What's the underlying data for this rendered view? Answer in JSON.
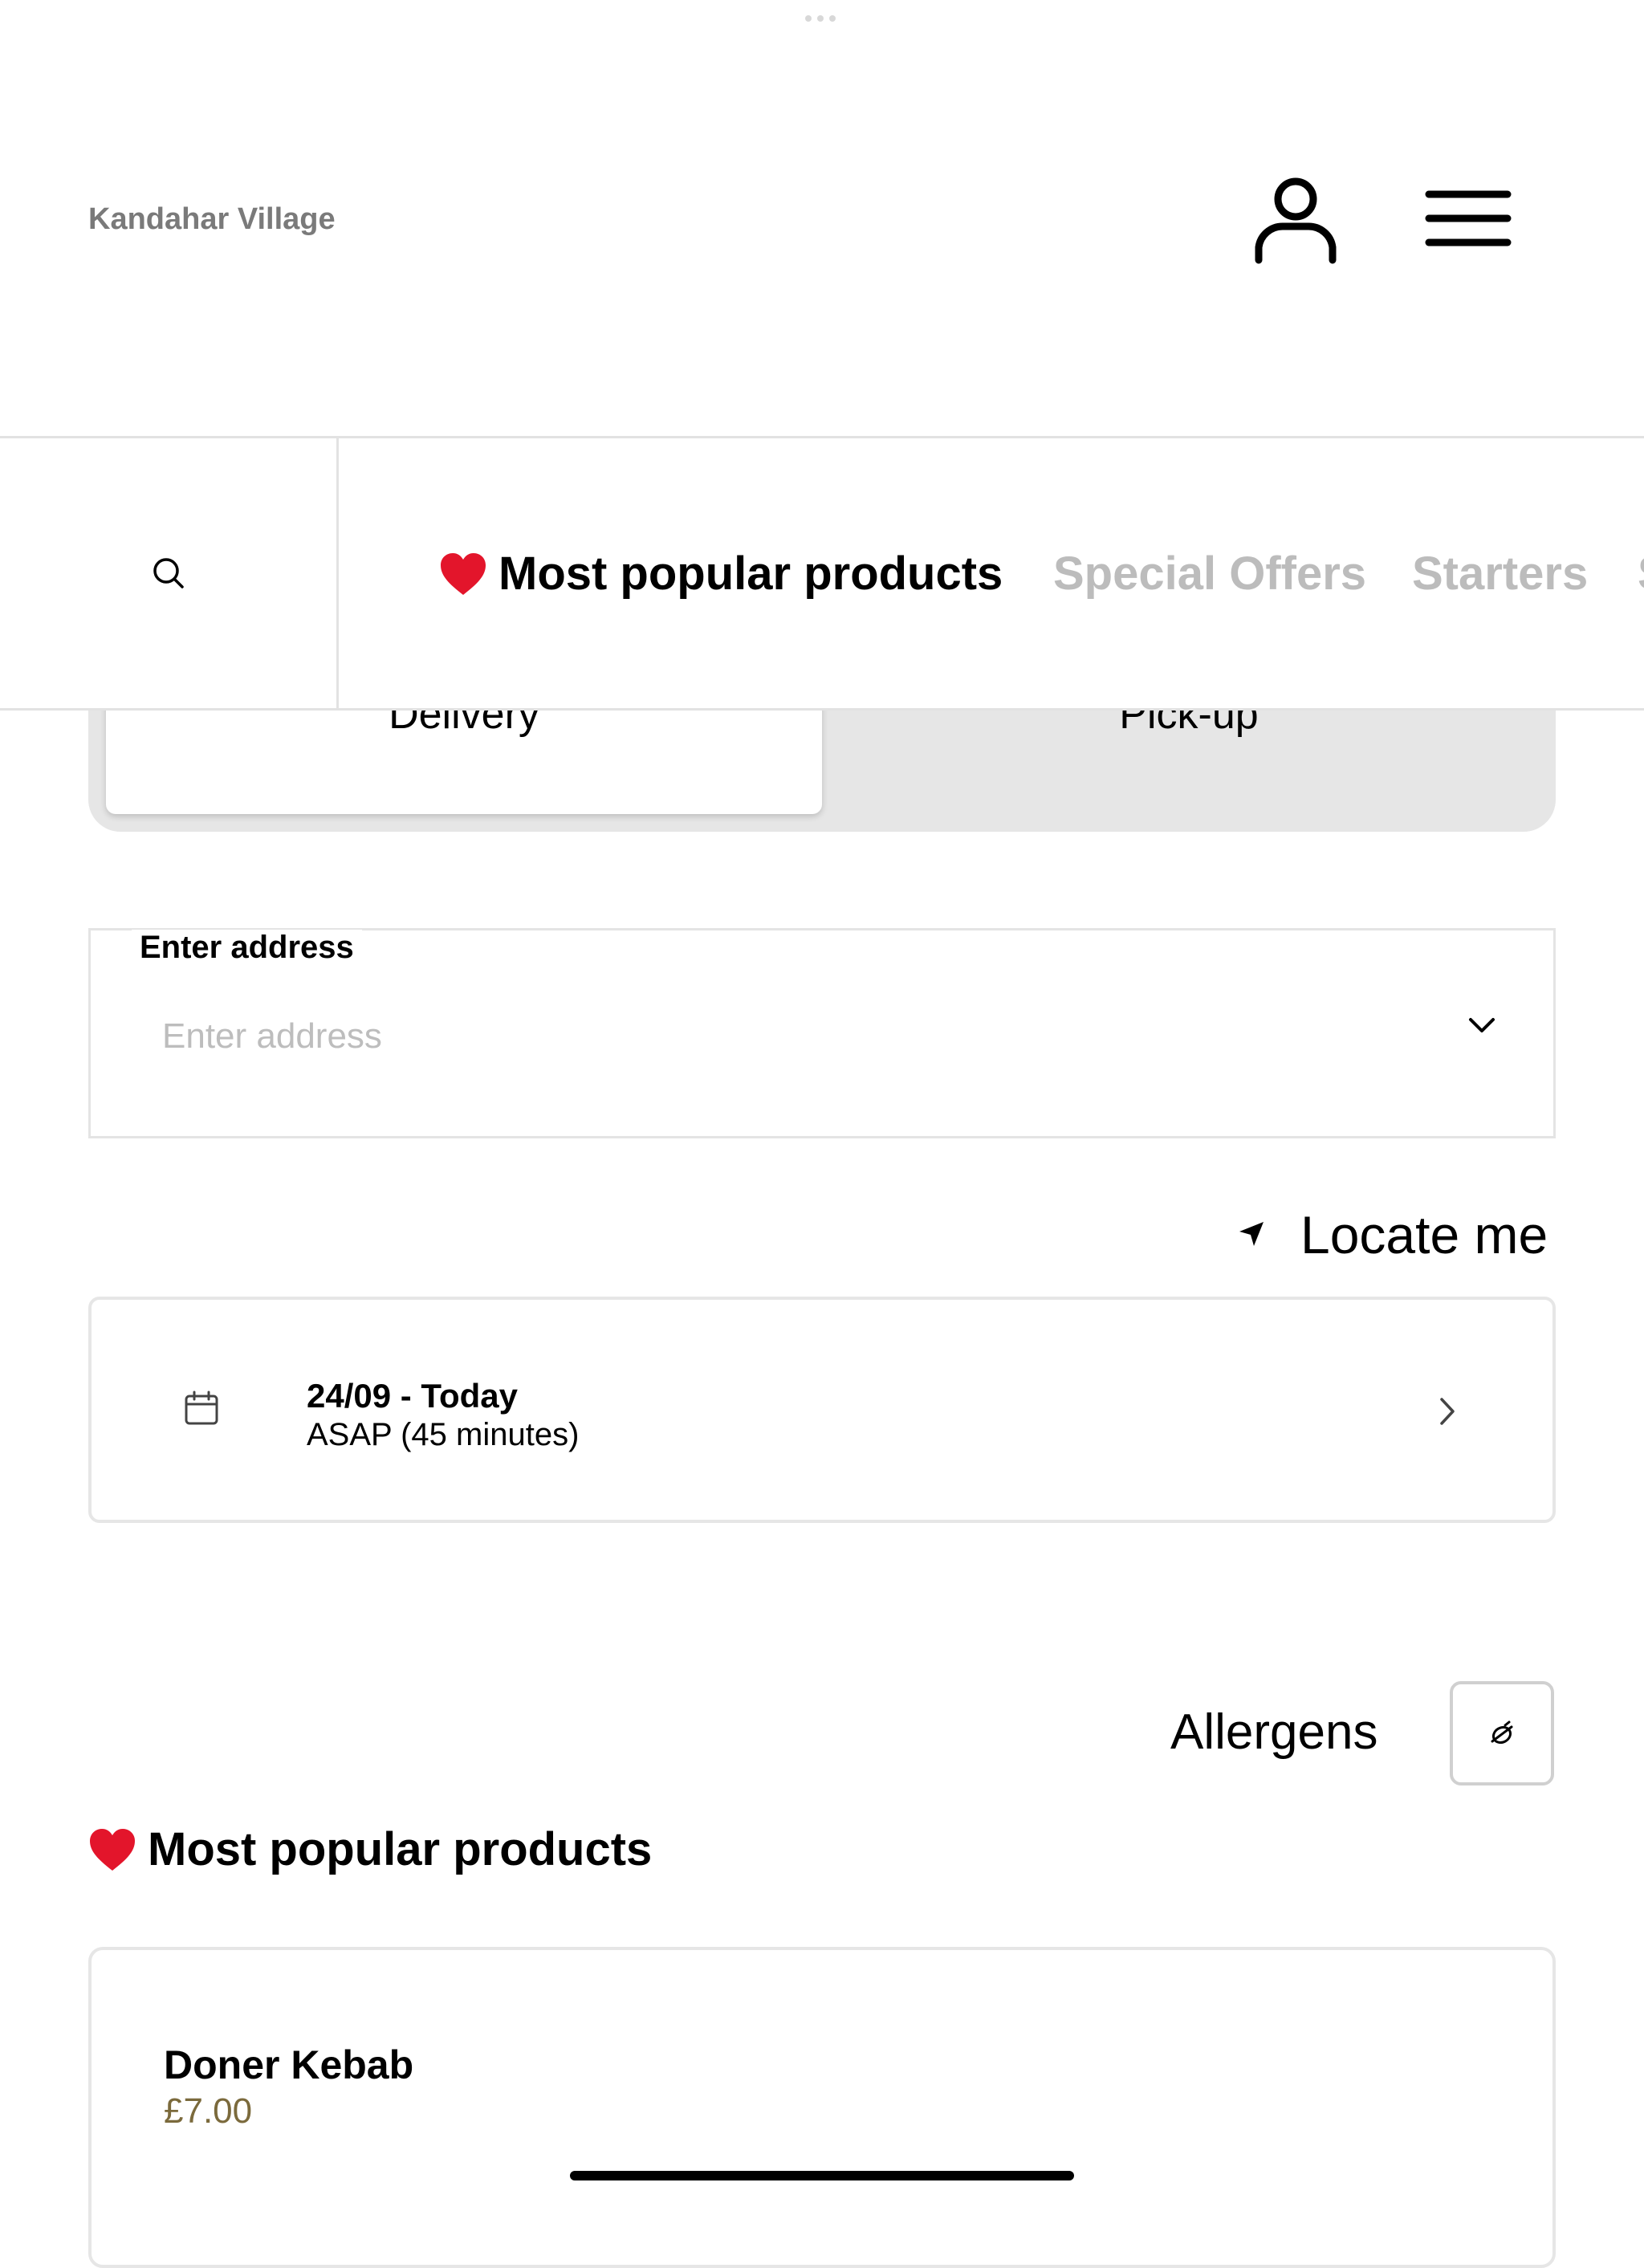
{
  "header": {
    "brand": "Kandahar Village",
    "icons": {
      "account": "user-icon",
      "menu": "hamburger-menu-icon"
    }
  },
  "nav": {
    "search_icon": "search-icon",
    "tabs": [
      {
        "label": "Most popular products",
        "emoji": "heart-icon",
        "active": true
      },
      {
        "label": "Special Offers",
        "active": false
      },
      {
        "label": "Starters",
        "active": false
      }
    ]
  },
  "order_mode": {
    "options": [
      "Delivery",
      "Pick-up"
    ],
    "selected": "Delivery"
  },
  "address": {
    "label": "Enter address",
    "placeholder": "Enter address",
    "value": ""
  },
  "locate": {
    "label": "Locate me"
  },
  "schedule": {
    "date": "24/09 - Today",
    "time": "ASAP (45 minutes)"
  },
  "allergens": {
    "label": "Allergens"
  },
  "section": {
    "title": "Most popular products"
  },
  "products": [
    {
      "name": "Doner Kebab",
      "price": "£7.00"
    }
  ],
  "colors": {
    "accent_price": "#7b6a3c",
    "inactive_tab": "#bcbcbc",
    "heart": "#e3152b"
  }
}
